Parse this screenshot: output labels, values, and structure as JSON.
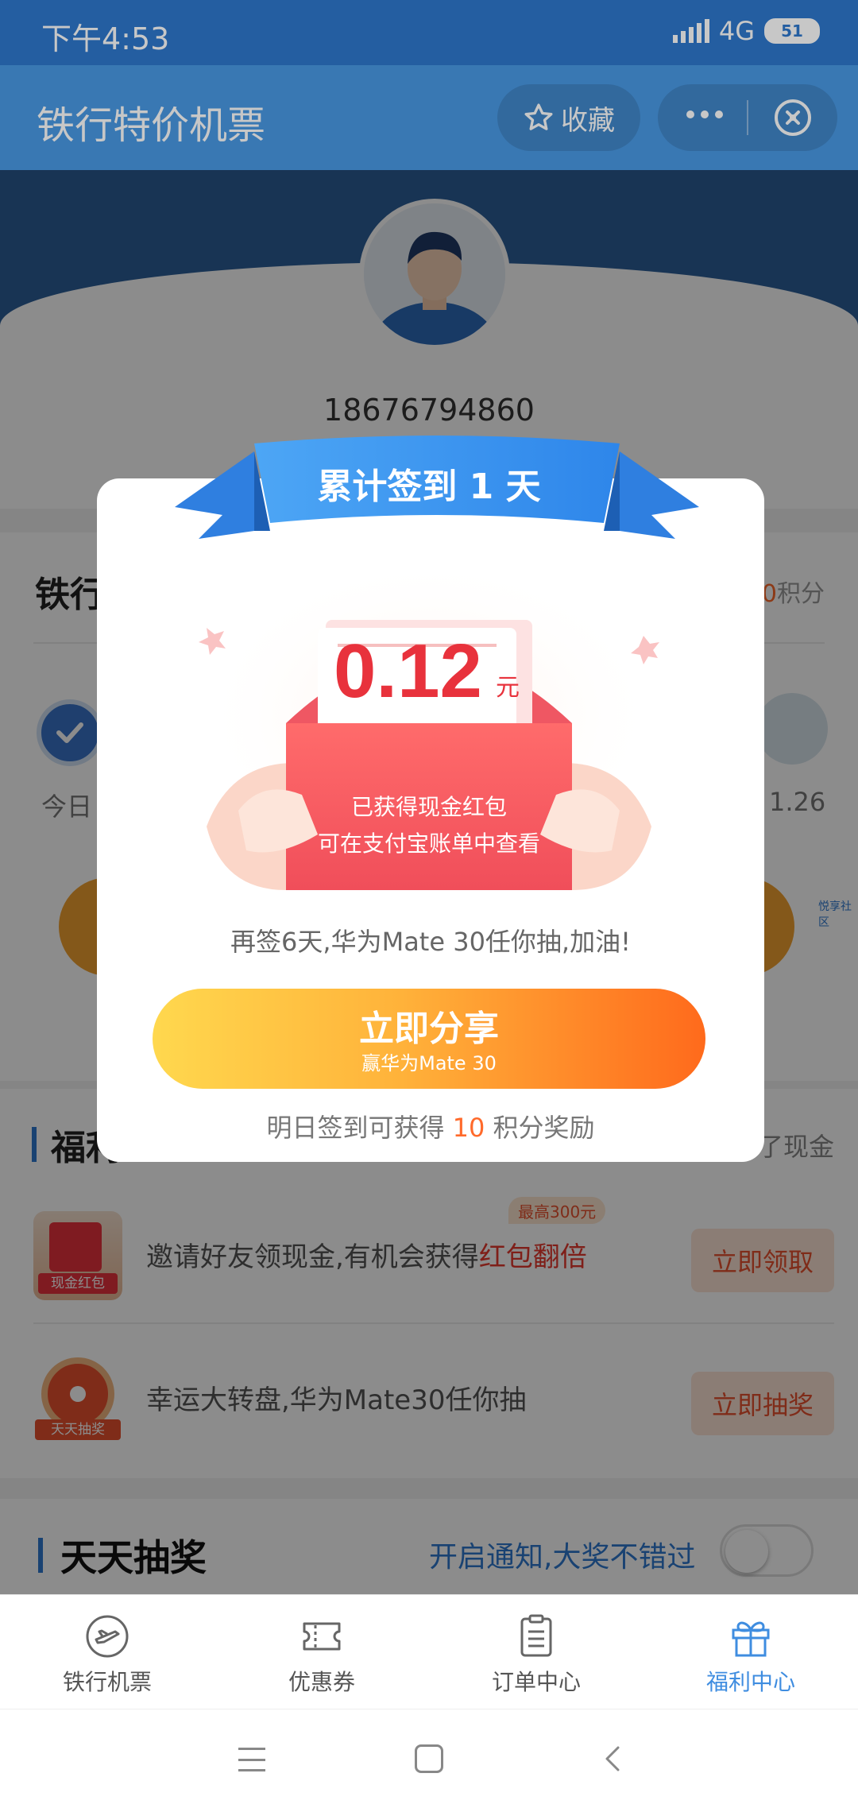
{
  "status": {
    "time": "下午4:53",
    "network": "4G",
    "battery": "51"
  },
  "header": {
    "title": "铁行特价机票",
    "favorite_label": "收藏"
  },
  "profile": {
    "phone": "18676794860"
  },
  "sign": {
    "title": "铁行",
    "points_value": "0",
    "points_unit": "积分",
    "today_label": "今日",
    "prize_date": "1.26",
    "tiny_tag": "悦享社区"
  },
  "welfare": {
    "title": "福利",
    "right_text": "了现金",
    "tasks": [
      {
        "icon_label": "现金红包",
        "text_prefix": "邀请好友领现金,有机会获得",
        "text_highlight": "红包翻倍",
        "tag": "最高300元",
        "button": "立即领取"
      },
      {
        "icon_label": "天天抽奖",
        "text_prefix": "幸运大转盘,华为Mate30任你抽",
        "text_highlight": "",
        "tag": "",
        "button": "立即抽奖"
      }
    ]
  },
  "lottery": {
    "title": "天天抽奖",
    "notify_text": "开启通知,大奖不错过",
    "toggle_on": false
  },
  "popup": {
    "ribbon_title": "累计签到 1 天",
    "amount": "0.12",
    "amount_unit": "元",
    "env_line1": "已获得现金红包",
    "env_line2": "可在支付宝账单中查看",
    "hint": "再签6天,华为Mate 30任你抽,加油!",
    "share_label": "立即分享",
    "share_sub": "赢华为Mate 30",
    "tomorrow_prefix": "明日签到可获得 ",
    "tomorrow_points": "10",
    "tomorrow_suffix": " 积分奖励"
  },
  "tabs": [
    {
      "label": "铁行机票",
      "icon": "plane-badge-icon",
      "active": false
    },
    {
      "label": "优惠券",
      "icon": "ticket-icon",
      "active": false
    },
    {
      "label": "订单中心",
      "icon": "order-list-icon",
      "active": false
    },
    {
      "label": "福利中心",
      "icon": "gift-icon",
      "active": true
    }
  ],
  "colors": {
    "accent": "#3f8de0",
    "red": "#e8323c",
    "orange": "#ff6a2b"
  }
}
